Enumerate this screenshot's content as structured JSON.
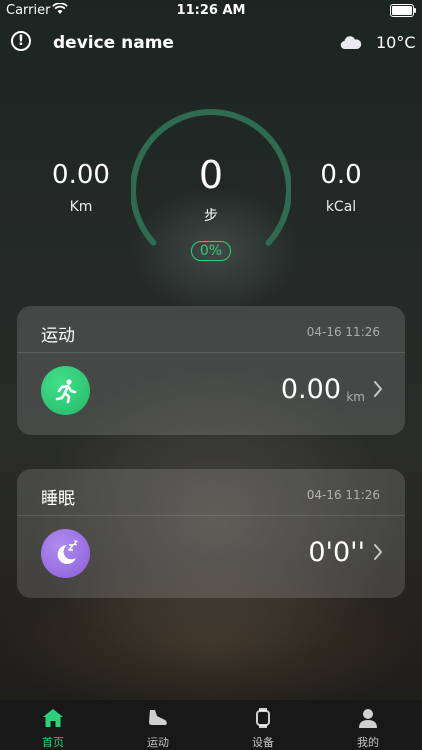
{
  "status_bar": {
    "carrier": "Carrier",
    "time": "11:26 AM"
  },
  "header": {
    "device_name": "device name",
    "temperature": "10°C",
    "weather_icon": "cloud-icon",
    "info_icon": "info-icon"
  },
  "stats": {
    "distance": {
      "value": "0.00",
      "unit": "Km"
    },
    "steps": {
      "value": "0",
      "unit": "步",
      "progress_label": "0%",
      "progress": 0
    },
    "calories": {
      "value": "0.0",
      "unit": "kCal"
    }
  },
  "cards": [
    {
      "title": "运动",
      "date": "04-16 11:26",
      "value": "0.00",
      "unit": "km",
      "icon": "running-icon",
      "icon_color": "#2fd07b"
    },
    {
      "title": "睡眠",
      "date": "04-16 11:26",
      "value": "0'0''",
      "unit": "",
      "icon": "moon-sleep-icon",
      "icon_color": "#9a72e3"
    }
  ],
  "tabs": [
    {
      "label": "首页",
      "icon": "home-icon",
      "active": true
    },
    {
      "label": "运动",
      "icon": "shoe-icon",
      "active": false
    },
    {
      "label": "设备",
      "icon": "watch-icon",
      "active": false
    },
    {
      "label": "我的",
      "icon": "user-icon",
      "active": false
    }
  ],
  "colors": {
    "accent": "#2fd07b",
    "gauge_track": "#2e6b52",
    "sleep": "#9a72e3"
  }
}
